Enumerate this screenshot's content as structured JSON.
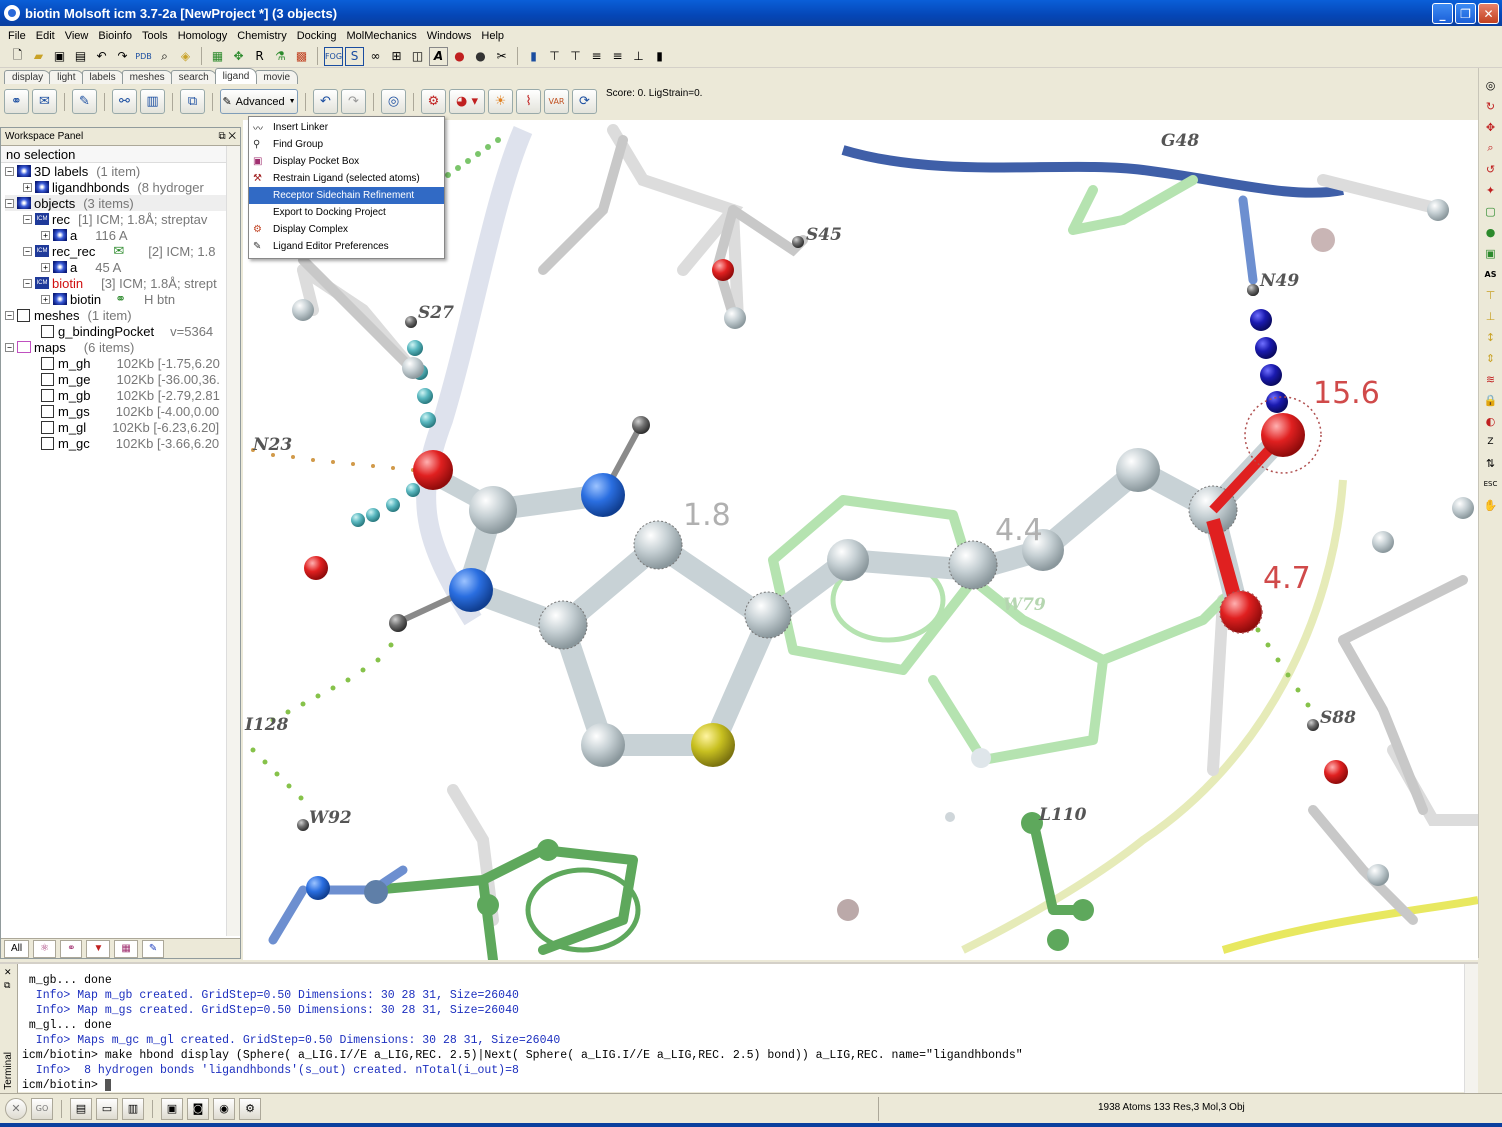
{
  "window": {
    "title": "biotin Molsoft icm 3.7-2a  [NewProject *] (3 objects)"
  },
  "menubar": [
    "File",
    "Edit",
    "View",
    "Bioinfo",
    "Tools",
    "Homology",
    "Chemistry",
    "Docking",
    "MolMechanics",
    "Windows",
    "Help"
  ],
  "tabs": [
    "display",
    "light",
    "labels",
    "meshes",
    "search",
    "ligand",
    "movie"
  ],
  "active_tab": "ligand",
  "toolbar2": {
    "advanced_label": "Advanced",
    "score_text": "Score: 0. LigStrain=0."
  },
  "panel": {
    "title": "Workspace Panel",
    "selection": "no selection",
    "tree": [
      {
        "label": "3D labels",
        "info": "(1 item)"
      },
      {
        "label": "ligandhbonds",
        "info": "(8 hydroger"
      },
      {
        "label": "objects",
        "info": "(3 items)"
      },
      {
        "label": "rec",
        "info": "[1] ICM; 1.8Å; streptav"
      },
      {
        "label": "a",
        "info": "116 A"
      },
      {
        "label": "rec_rec",
        "info": "[2] ICM; 1.8"
      },
      {
        "label": "a",
        "info": "45 A"
      },
      {
        "label": "biotin",
        "info": "[3] ICM; 1.8Å; strept"
      },
      {
        "label": "biotin",
        "info": "H   btn"
      },
      {
        "label": "meshes",
        "info": "(1 item)"
      },
      {
        "label": "g_bindingPocket",
        "info": "v=5364"
      },
      {
        "label": "maps",
        "info": "(6 items)"
      },
      {
        "label": "m_gh",
        "info": "102Kb [-1.75,6.20"
      },
      {
        "label": "m_ge",
        "info": "102Kb [-36.00,36."
      },
      {
        "label": "m_gb",
        "info": "102Kb [-2.79,2.81"
      },
      {
        "label": "m_gs",
        "info": "102Kb [-4.00,0.00"
      },
      {
        "label": "m_gl",
        "info": "102Kb [-6.23,6.20]"
      },
      {
        "label": "m_gc",
        "info": "102Kb [-3.66,6.20"
      }
    ],
    "bottom_tab": "All"
  },
  "menu": [
    {
      "icon": "linker-icon",
      "label": "Insert Linker"
    },
    {
      "icon": "find-group-icon",
      "label": "Find Group"
    },
    {
      "icon": "pocket-box-icon",
      "label": "Display Pocket Box"
    },
    {
      "icon": "restrain-icon",
      "label": "Restrain Ligand (selected atoms)"
    },
    {
      "icon": "",
      "label": "Receptor Sidechain Refinement"
    },
    {
      "icon": "",
      "label": "Export to Docking Project"
    },
    {
      "icon": "complex-icon",
      "label": "Display Complex"
    },
    {
      "icon": "preferences-icon",
      "label": "Ligand Editor Preferences"
    }
  ],
  "highlighted_menu_item": "Receptor Sidechain Refinement",
  "viewport": {
    "residue_labels": [
      "G48",
      "S45",
      "S27",
      "N49",
      "N23",
      "W79",
      "I128",
      "S88",
      "W92",
      "L110"
    ],
    "distance_labels": [
      "1.8",
      "4.4",
      "15.6",
      "4.7"
    ]
  },
  "terminal": {
    "label": "Terminal",
    "lines": [
      {
        "text": " m_gb... done",
        "style": "plain"
      },
      {
        "text": "  Info> Map m_gb created. GridStep=0.50 Dimensions: 30 28 31, Size=26040",
        "style": "blue"
      },
      {
        "text": "  Info> Map m_gs created. GridStep=0.50 Dimensions: 30 28 31, Size=26040",
        "style": "blue"
      },
      {
        "text": " m_gl... done",
        "style": "plain"
      },
      {
        "text": "  Info> Maps m_gc m_gl created. GridStep=0.50 Dimensions: 30 28 31, Size=26040",
        "style": "blue"
      },
      {
        "text": "icm/biotin> make hbond display (Sphere( a_LIG.I//E a_LIG,REC. 2.5)|Next( Sphere( a_LIG.I//E a_LIG,REC. 2.5) bond)) a_LIG,REC. name=\"ligandhbonds\"",
        "style": "plain"
      },
      {
        "text": "  Info>  8 hydrogen bonds 'ligandhbonds'(s_out) created. nTotal(i_out)=8",
        "style": "blue"
      },
      {
        "text": "icm/biotin> ",
        "style": "plain"
      }
    ]
  },
  "status": {
    "text": "1938 Atoms 133 Res,3 Mol,3 Obj"
  }
}
